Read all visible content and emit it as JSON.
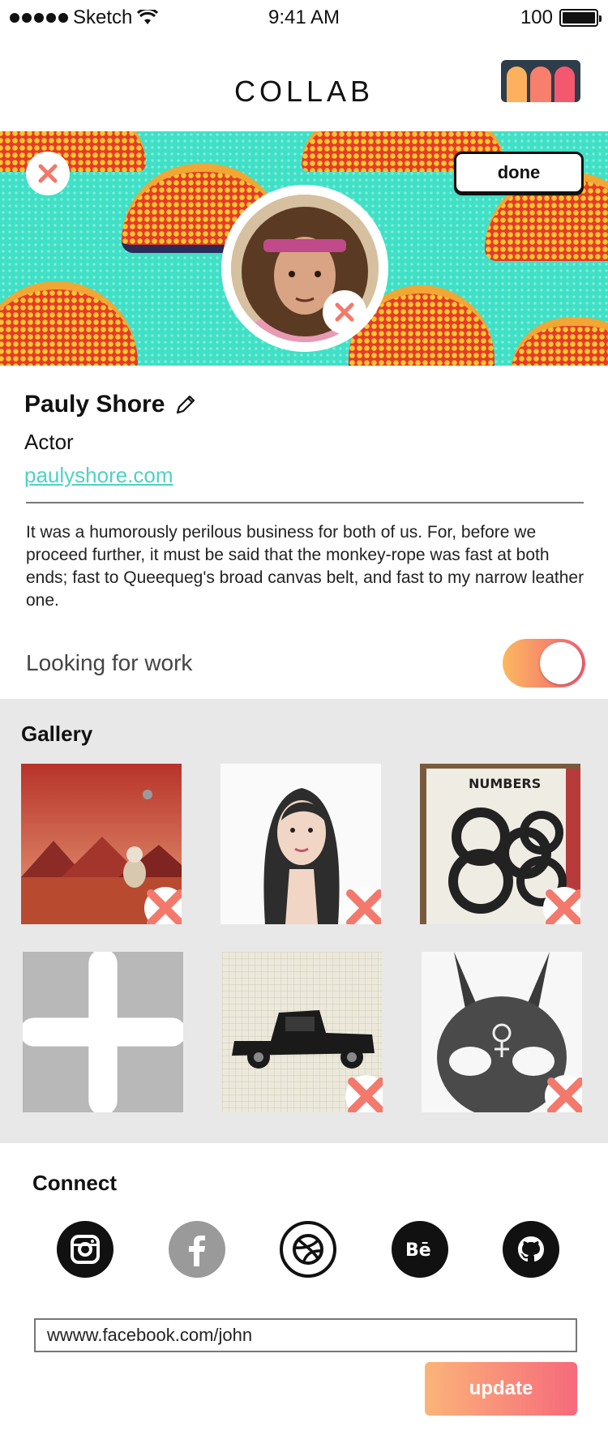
{
  "status_bar": {
    "carrier": "Sketch",
    "time": "9:41 AM",
    "battery_percent": "100",
    "signal_icon": "signal-dots-icon",
    "wifi_icon": "wifi-icon",
    "battery_icon": "battery-icon"
  },
  "header": {
    "title": "COLLAB",
    "logo_icon": "collab-logo-icon",
    "logo_colors": [
      "#fdb15f",
      "#f77f6b",
      "#f4586f"
    ]
  },
  "cover": {
    "done_label": "done",
    "remove_icon": "close-icon",
    "background_color": "#3fe0c6"
  },
  "profile": {
    "name": "Pauly Shore",
    "edit_icon": "pencil-icon",
    "role": "Actor",
    "website": "paulyshore.com",
    "bio": "It was a humorously perilous business for both of us. For, before we proceed further, it must be said that the monkey-rope was fast at both ends; fast to Queequeg's broad canvas belt, and fast to my narrow leather one.",
    "looking_for_work_label": "Looking for work",
    "looking_for_work": true
  },
  "gallery": {
    "title": "Gallery",
    "items": [
      {
        "name": "mars-astronaut-art"
      },
      {
        "name": "woman-watercolor-portrait"
      },
      {
        "name": "numbers-808-sketchbook"
      },
      {
        "name": "add-photo",
        "icon": "plus-icon"
      },
      {
        "name": "black-pickup-truck-drawing"
      },
      {
        "name": "bunny-mask-illustration"
      }
    ]
  },
  "connect": {
    "title": "Connect",
    "socials": [
      {
        "icon": "instagram-icon"
      },
      {
        "icon": "facebook-icon"
      },
      {
        "icon": "dribbble-icon"
      },
      {
        "icon": "behance-icon"
      },
      {
        "icon": "github-icon"
      }
    ],
    "url_value": "wwww.facebook.com/john",
    "update_label": "update"
  },
  "colors": {
    "accent_teal": "#4fd1c5",
    "remove_x": "#f2796b",
    "gradient_start": "#fbb95f",
    "gradient_end": "#f45d74"
  }
}
